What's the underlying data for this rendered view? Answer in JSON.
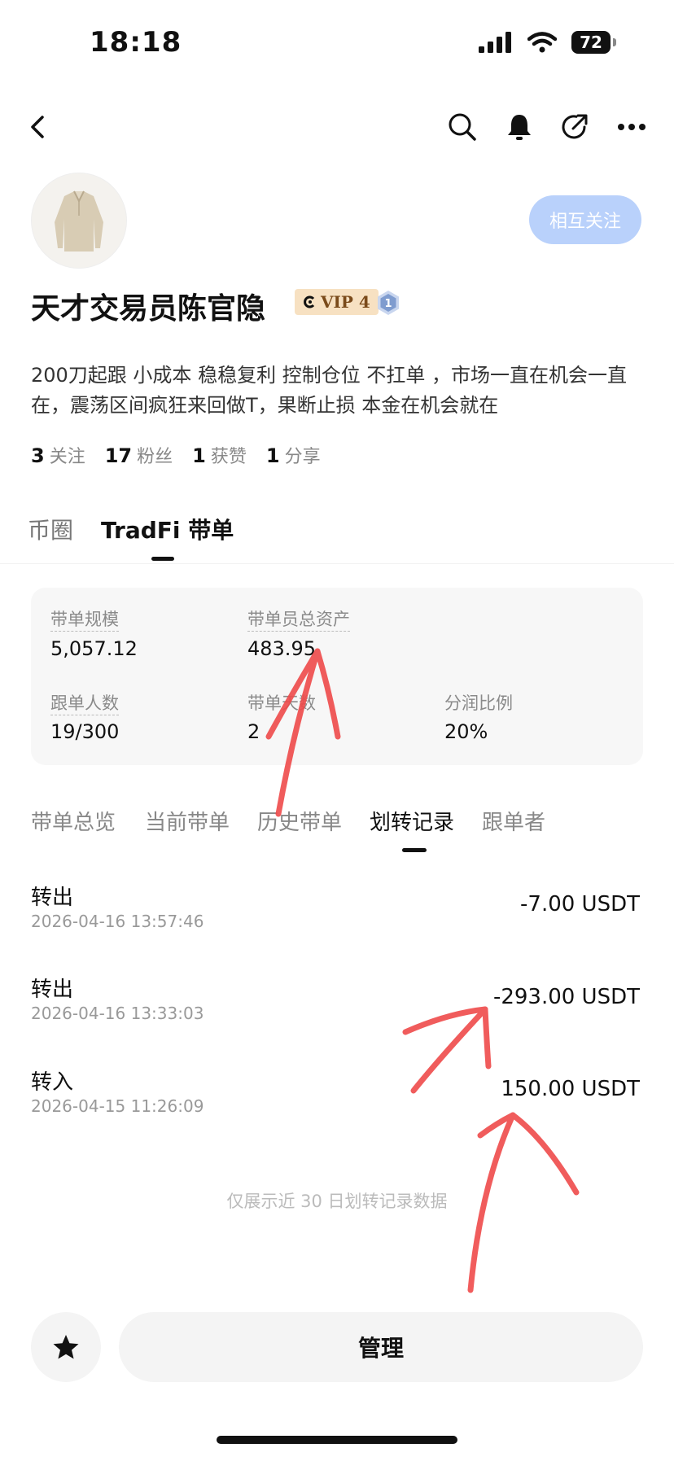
{
  "status_bar": {
    "time": "18:18",
    "battery": "72"
  },
  "profile": {
    "name": "天才交易员陈官隐",
    "vip_badge": "VIP 4",
    "level_badge": "1",
    "follow_label": "相互关注",
    "bio": "200刀起跟 小成本 稳稳复利 控制仓位 不扛单 ，市场一直在机会一直在，震荡区间疯狂来回做T，果断止损 本金在机会就在",
    "stats": [
      {
        "value": "3",
        "label": "关注"
      },
      {
        "value": "17",
        "label": "粉丝"
      },
      {
        "value": "1",
        "label": "获赞"
      },
      {
        "value": "1",
        "label": "分享"
      }
    ]
  },
  "main_tabs": [
    "币圈",
    "TradFi 带单"
  ],
  "overview": {
    "scale_label": "带单规模",
    "scale_value": "5,057.12",
    "assets_label": "带单员总资产",
    "assets_value": "483.95",
    "followers_label": "跟单人数",
    "followers_value": "19/300",
    "days_label": "带单天数",
    "days_value": "2",
    "share_label": "分润比例",
    "share_value": "20%"
  },
  "sub_tabs": [
    "带单总览",
    "当前带单",
    "历史带单",
    "划转记录",
    "跟单者"
  ],
  "records": [
    {
      "type": "转出",
      "time": "2026-04-16 13:57:46",
      "amount": "-7.00 USDT"
    },
    {
      "type": "转出",
      "time": "2026-04-16 13:33:03",
      "amount": "-293.00 USDT"
    },
    {
      "type": "转入",
      "time": "2026-04-15 11:26:09",
      "amount": "150.00 USDT"
    }
  ],
  "note": "仅展示近 30 日划转记录数据",
  "bottom": {
    "manage_label": "管理"
  },
  "colors": {
    "follow_bg": "#b9d1fb",
    "vip_bg": "#f7e1c2",
    "annotation": "#ef4b4b"
  }
}
